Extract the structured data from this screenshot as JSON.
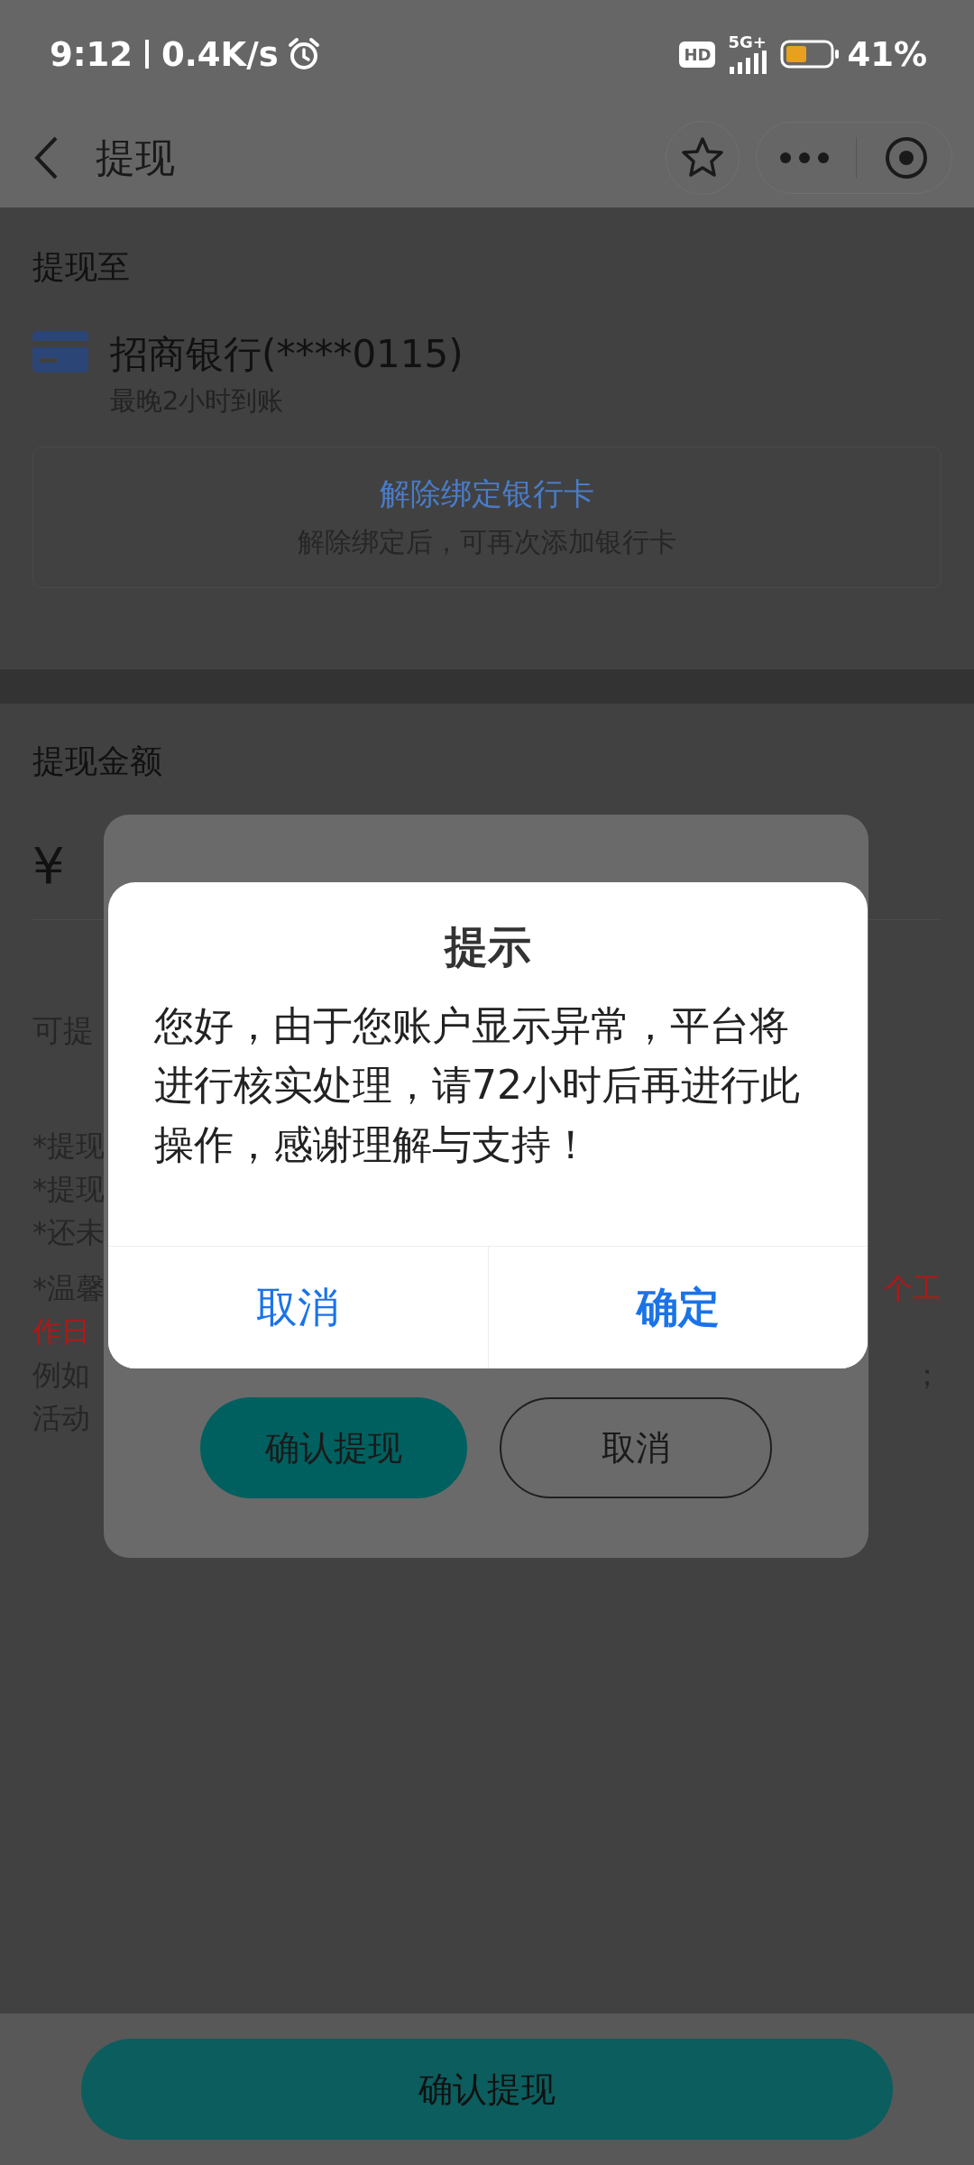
{
  "status_bar": {
    "time": "9:12",
    "speed": "0.4K/s",
    "hd": "HD",
    "network": "5G+",
    "battery": "41%"
  },
  "nav": {
    "title": "提现"
  },
  "withdraw_to": {
    "heading": "提现至",
    "bank_name": "招商银行(****0115)",
    "arrival": "最晚2小时到账",
    "unbind": {
      "label": "解除绑定银行卡",
      "hint": "解除绑定后，可再次添加银行卡"
    }
  },
  "amount": {
    "heading": "提现金额",
    "currency": "¥",
    "available": "可提",
    "note_lines": [
      {
        "left": {
          "text": "*提现",
          "warning": false
        }
      },
      {
        "left": {
          "text": "*提现",
          "warning": false
        }
      },
      {
        "left": {
          "text": "*还未",
          "warning": false
        }
      },
      {
        "left": {
          "text": "*温馨",
          "warning": false
        },
        "right": {
          "text": "个工",
          "warning": true
        }
      },
      {
        "left": {
          "text": "作日",
          "warning": true
        }
      },
      {
        "left": {
          "text": "例如",
          "warning": false
        },
        "right": {
          "text": "；",
          "warning": false
        }
      },
      {
        "left": {
          "text": "活动",
          "warning": false
        }
      }
    ]
  },
  "submit": {
    "label": "确认提现"
  },
  "notice_dialog": {
    "buttons": [
      {
        "label": "确认提现",
        "kind": "primary"
      },
      {
        "label": "取消",
        "kind": "outline"
      }
    ]
  },
  "alert_dialog": {
    "title": "提示",
    "message": "您好，由于您账户显示异常，平台将进行核实处理，请72小时后再进行此操作，感谢理解与支持！",
    "buttons": [
      {
        "label": "取消",
        "kind": "cancel"
      },
      {
        "label": "确定",
        "kind": "confirm"
      }
    ]
  }
}
